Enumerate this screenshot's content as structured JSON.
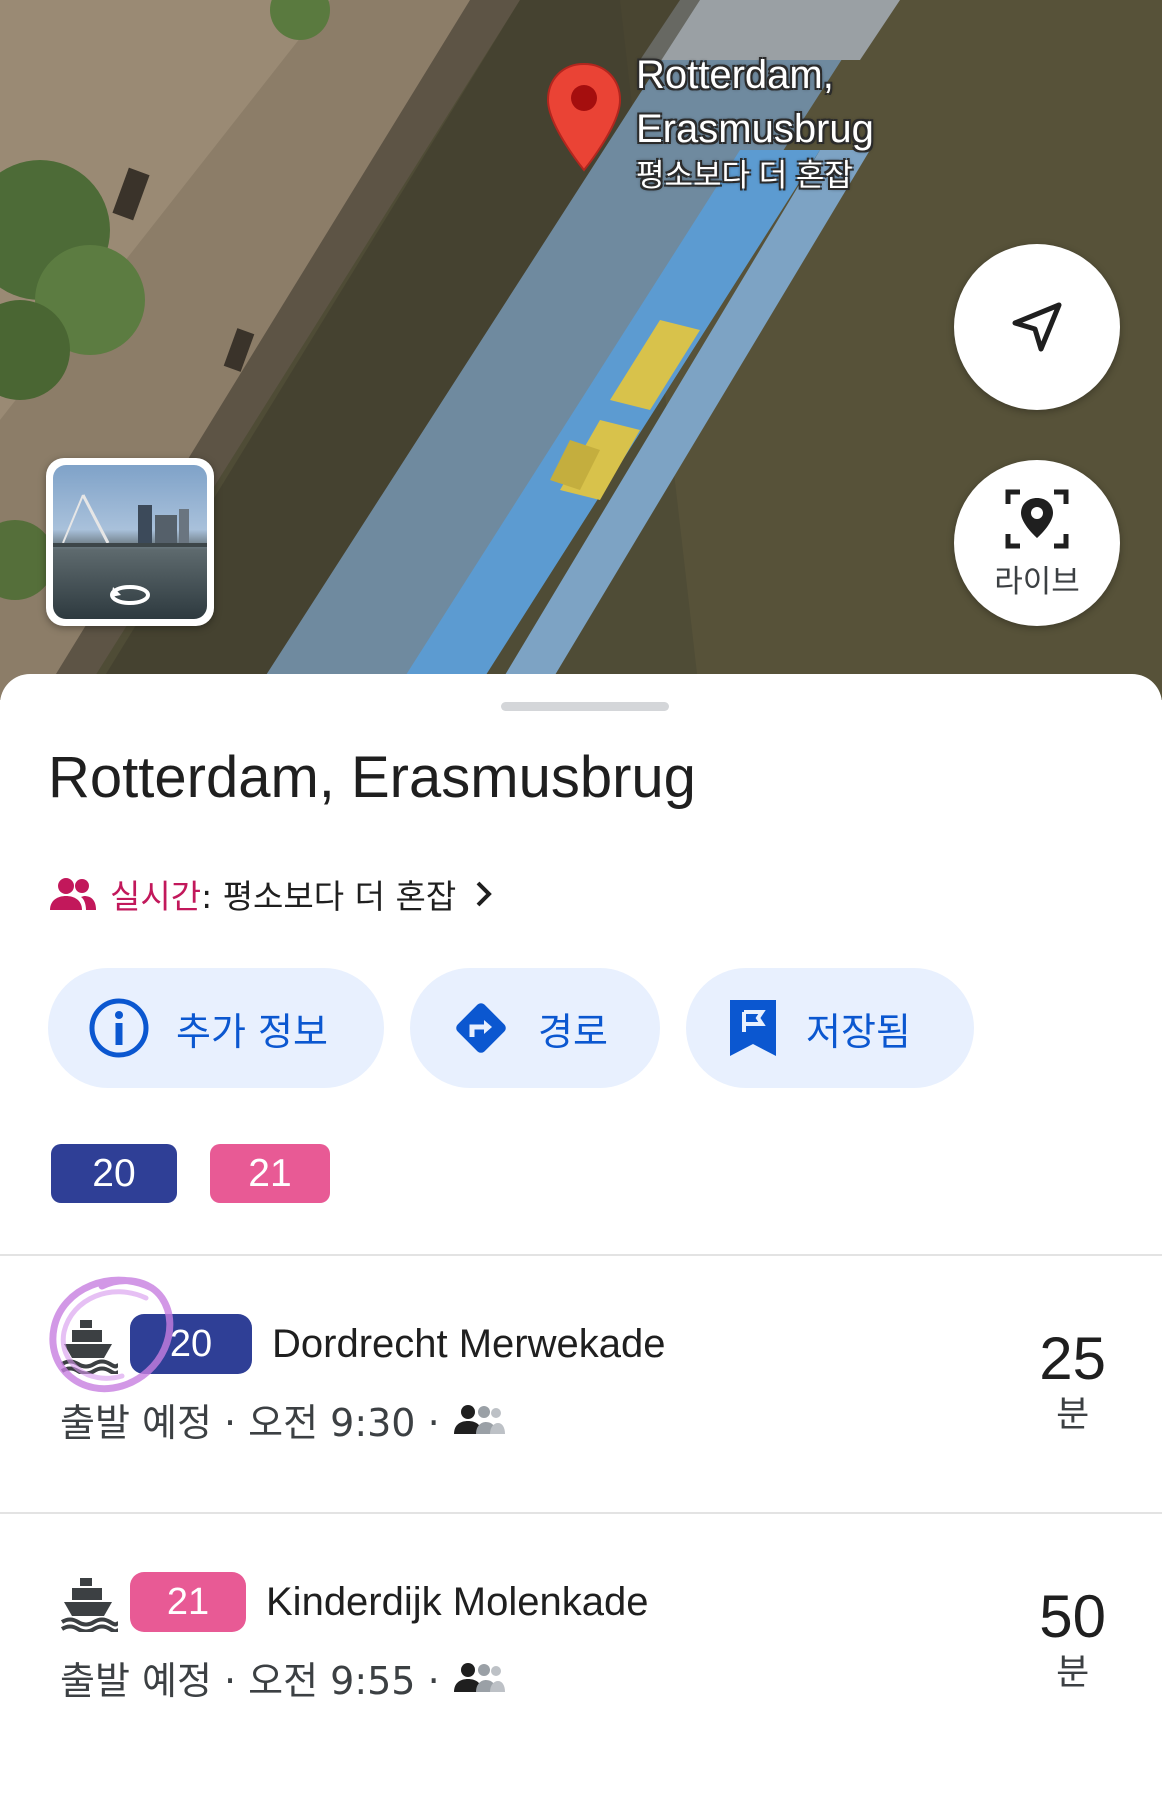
{
  "map": {
    "place_label_line1": "Rotterdam,",
    "place_label_line2": "Erasmusbrug",
    "busyness_label": "평소보다 더 혼잡",
    "pin_icon": "red-map-pin-icon",
    "streetview_icon": "rotate-360-icon",
    "navigate_icon": "navigation-arrow-icon",
    "live_button_label": "라이브",
    "live_icon": "live-view-pin-icon"
  },
  "sheet": {
    "title": "Rotterdam, Erasmusbrug",
    "live_prefix": "실시간",
    "live_status": ": 평소보다 더 혼잡",
    "actions": [
      {
        "label": "추가 정보",
        "icon": "info-icon"
      },
      {
        "label": "경로",
        "icon": "directions-icon"
      },
      {
        "label": "저장됨",
        "icon": "saved-flag-icon"
      }
    ],
    "routes": [
      "20",
      "21"
    ]
  },
  "departures": [
    {
      "route": "20",
      "destination": "Dordrecht Merwekade",
      "status": "출발 예정 · 오전 9:30 ·",
      "eta_value": "25",
      "eta_unit": "분",
      "color": "#2f3f96"
    },
    {
      "route": "21",
      "destination": "Kinderdijk Molenkade",
      "status": "출발 예정 · 오전 9:55 ·",
      "eta_value": "50",
      "eta_unit": "분",
      "color": "#e85a95"
    }
  ],
  "colors": {
    "accent_blue": "#0b57d0",
    "action_bg": "#e8f0fe",
    "live_pink": "#c2185b",
    "route20": "#2f3f96",
    "route21": "#e85a95",
    "pin_red": "#ea4335"
  }
}
